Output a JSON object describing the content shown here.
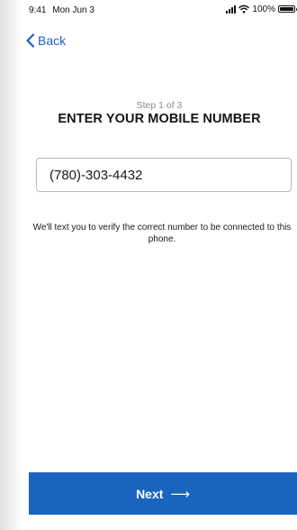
{
  "status_bar": {
    "time": "9:41",
    "date": "Mon Jun 3",
    "battery_percent": "100%"
  },
  "nav": {
    "back_label": "Back"
  },
  "step": {
    "label": "Step 1 of 3"
  },
  "title": "ENTER YOUR MOBILE NUMBER",
  "phone_field": {
    "value": "(780)-303-4432"
  },
  "helper_text": "We'll text you to verify the correct number to be connected to this phone.",
  "next_button": {
    "label": "Next",
    "arrow": "⟶"
  },
  "colors": {
    "accent": "#1b63c9",
    "button_bg": "#1a64bf",
    "step_text": "#8a8a8a"
  },
  "icons": [
    "signal-icon",
    "wifi-icon",
    "battery-icon",
    "chevron-left-icon",
    "arrow-right-icon"
  ]
}
